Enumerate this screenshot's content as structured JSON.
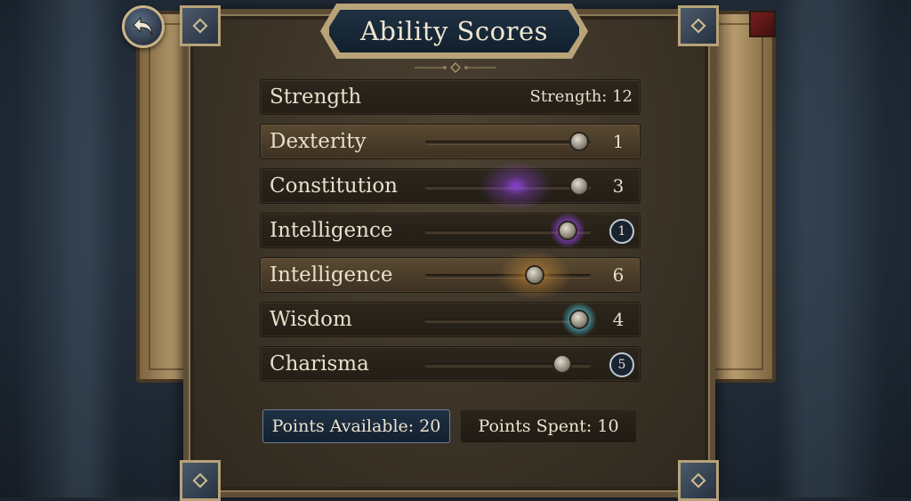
{
  "title": "Ability Scores",
  "back_button": {
    "icon": "back-arrow-icon"
  },
  "abilities": [
    {
      "label": "Strength",
      "display": "Strength: 12"
    },
    {
      "label": "Dexterity",
      "value": "1",
      "slider": 0.93,
      "highlighted": true
    },
    {
      "label": "Constitution",
      "value": "3",
      "slider": 0.93,
      "effect": "purple"
    },
    {
      "label": "Intelligence",
      "value": "1",
      "slider": 0.86,
      "value_style": "circle",
      "knob_glow": "purple"
    },
    {
      "label": "Intelligence",
      "value": "6",
      "slider": 0.66,
      "effect": "gold",
      "highlighted": true
    },
    {
      "label": "Wisdom",
      "value": "4",
      "slider": 0.93,
      "knob_glow": "cyan"
    },
    {
      "label": "Charisma",
      "value": "5",
      "slider": 0.83,
      "value_style": "circle"
    }
  ],
  "points_available": "Points Available: 20",
  "points_spent": "Points Spent: 10",
  "colors": {
    "accent_gold": "#b9a47a",
    "purple_glow": "#a24bff",
    "cyan_glow": "#4fd3e6",
    "gold_glow": "#f0a23a"
  }
}
